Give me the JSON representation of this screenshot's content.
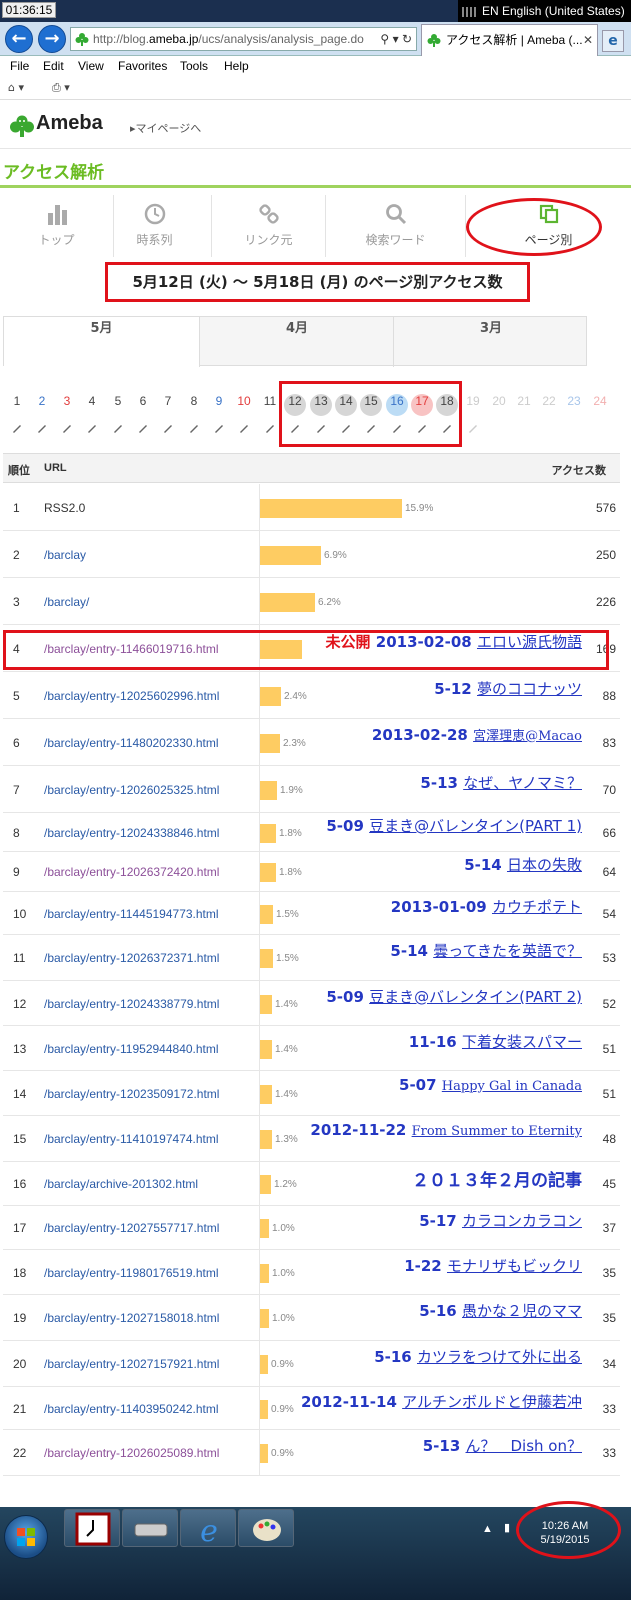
{
  "titlebar": {
    "clock": "01:36:15",
    "language": "EN English (United States)"
  },
  "browser": {
    "address": {
      "prefix": "http://blog.",
      "host": "ameba.jp",
      "path": "/ucs/analysis/analysis_page.do"
    },
    "tab_title": "アクセス解析 | Ameba (...",
    "menu": [
      "File",
      "Edit",
      "View",
      "Favorites",
      "Tools",
      "Help"
    ]
  },
  "header": {
    "logo": "Ameba",
    "mypage_link": "マイページへ",
    "section_title": "アクセス解析",
    "brand_color": "#6bbc23"
  },
  "nav": {
    "items": [
      {
        "label": "トップ",
        "icon": "bar-chart-icon"
      },
      {
        "label": "時系列",
        "icon": "clock-icon"
      },
      {
        "label": "リンク元",
        "icon": "link-icon"
      },
      {
        "label": "検索ワード",
        "icon": "search-icon"
      },
      {
        "label": "ページ別",
        "icon": "pages-icon",
        "active": true
      }
    ]
  },
  "period_title": "5月12日 (火) 〜 5月18日 (月) のページ別アクセス数",
  "months": [
    "5月",
    "4月",
    "3月"
  ],
  "days": [
    "1",
    "2",
    "3",
    "4",
    "5",
    "6",
    "7",
    "8",
    "9",
    "10",
    "11",
    "12",
    "13",
    "14",
    "15",
    "16",
    "17",
    "18",
    "19",
    "20",
    "21",
    "22",
    "23",
    "24"
  ],
  "table": {
    "headers": {
      "rank": "順位",
      "url": "URL",
      "count": "アクセス数"
    }
  },
  "rows": [
    {
      "rank": "1",
      "url": "RSS2.0",
      "pct": "15.9%",
      "share": 0.159,
      "count": "576",
      "note": null
    },
    {
      "rank": "2",
      "url": "/barclay",
      "pct": "6.9%",
      "share": 0.069,
      "count": "250",
      "note": null
    },
    {
      "rank": "3",
      "url": "/barclay/",
      "pct": "6.2%",
      "share": 0.062,
      "count": "226",
      "note": null
    },
    {
      "rank": "4",
      "url": "/barclay/entry-11466019716.html",
      "pct": "",
      "share": 0.047,
      "count": "169",
      "note": {
        "tag": "未公開",
        "date": "2013-02-08",
        "title": "エロい源氏物語"
      }
    },
    {
      "rank": "5",
      "url": "/barclay/entry-12025602996.html",
      "pct": "2.4%",
      "share": 0.024,
      "count": "88",
      "note": {
        "date": "5-12",
        "title": "夢のココナッツ"
      }
    },
    {
      "rank": "6",
      "url": "/barclay/entry-11480202330.html",
      "pct": "2.3%",
      "share": 0.023,
      "count": "83",
      "note": {
        "date": "2013-02-28",
        "title": "宮澤理恵@Macao",
        "serif": true
      }
    },
    {
      "rank": "7",
      "url": "/barclay/entry-12026025325.html",
      "pct": "1.9%",
      "share": 0.019,
      "count": "70",
      "note": {
        "date": "5-13",
        "title": "なぜ、ヤノマミ？"
      }
    },
    {
      "rank": "8",
      "url": "/barclay/entry-12024338846.html",
      "pct": "1.8%",
      "share": 0.018,
      "count": "66",
      "note": {
        "date": "5-09",
        "title": "豆まき@バレンタイン(PART 1)"
      }
    },
    {
      "rank": "9",
      "url": "/barclay/entry-12026372420.html",
      "pct": "1.8%",
      "share": 0.018,
      "count": "64",
      "note": {
        "date": "5-14",
        "title": "日本の失敗"
      }
    },
    {
      "rank": "10",
      "url": "/barclay/entry-11445194773.html",
      "pct": "1.5%",
      "share": 0.015,
      "count": "54",
      "note": {
        "date": "2013-01-09",
        "title": "カウチポテト"
      }
    },
    {
      "rank": "11",
      "url": "/barclay/entry-12026372371.html",
      "pct": "1.5%",
      "share": 0.015,
      "count": "53",
      "note": {
        "date": "5-14",
        "title": "曇ってきたを英語で？"
      }
    },
    {
      "rank": "12",
      "url": "/barclay/entry-12024338779.html",
      "pct": "1.4%",
      "share": 0.014,
      "count": "52",
      "note": {
        "date": "5-09",
        "title": "豆まき@バレンタイン(PART 2)"
      }
    },
    {
      "rank": "13",
      "url": "/barclay/entry-11952944840.html",
      "pct": "1.4%",
      "share": 0.014,
      "count": "51",
      "note": {
        "date": "11-16",
        "title": "下着女装スパマー"
      }
    },
    {
      "rank": "14",
      "url": "/barclay/entry-12023509172.html",
      "pct": "1.4%",
      "share": 0.014,
      "count": "51",
      "note": {
        "date": "5-07",
        "title": "Happy Gal in Canada",
        "serif": true
      }
    },
    {
      "rank": "15",
      "url": "/barclay/entry-11410197474.html",
      "pct": "1.3%",
      "share": 0.013,
      "count": "48",
      "note": {
        "date": "2012-11-22",
        "title": "From Summer to Eternity",
        "serif": true
      }
    },
    {
      "rank": "16",
      "url": "/barclay/archive-201302.html",
      "pct": "1.2%",
      "share": 0.012,
      "count": "45",
      "note": {
        "date": "",
        "title": "２０１３年２月の記事",
        "plain": true
      }
    },
    {
      "rank": "17",
      "url": "/barclay/entry-12027557717.html",
      "pct": "1.0%",
      "share": 0.01,
      "count": "37",
      "note": {
        "date": "5-17",
        "title": "カラコンカラコン"
      }
    },
    {
      "rank": "18",
      "url": "/barclay/entry-11980176519.html",
      "pct": "1.0%",
      "share": 0.01,
      "count": "35",
      "note": {
        "date": "1-22",
        "title": "モナリザもビックリ"
      }
    },
    {
      "rank": "19",
      "url": "/barclay/entry-12027158018.html",
      "pct": "1.0%",
      "share": 0.01,
      "count": "35",
      "note": {
        "date": "5-16",
        "title": "愚かな２児のママ"
      }
    },
    {
      "rank": "20",
      "url": "/barclay/entry-12027157921.html",
      "pct": "0.9%",
      "share": 0.009,
      "count": "34",
      "note": {
        "date": "5-16",
        "title": "カツラをつけて外に出る"
      }
    },
    {
      "rank": "21",
      "url": "/barclay/entry-11403950242.html",
      "pct": "0.9%",
      "share": 0.009,
      "count": "33",
      "note": {
        "date": "2012-11-14",
        "title": "アルチンボルドと伊藤若冲"
      }
    },
    {
      "rank": "22",
      "url": "/barclay/entry-12026025089.html",
      "pct": "0.9%",
      "share": 0.009,
      "count": "33",
      "note": {
        "date": "5-13",
        "title": "ん？　Dish on？"
      }
    }
  ],
  "taskbar": {
    "time": "10:26 AM",
    "date": "5/19/2015"
  }
}
